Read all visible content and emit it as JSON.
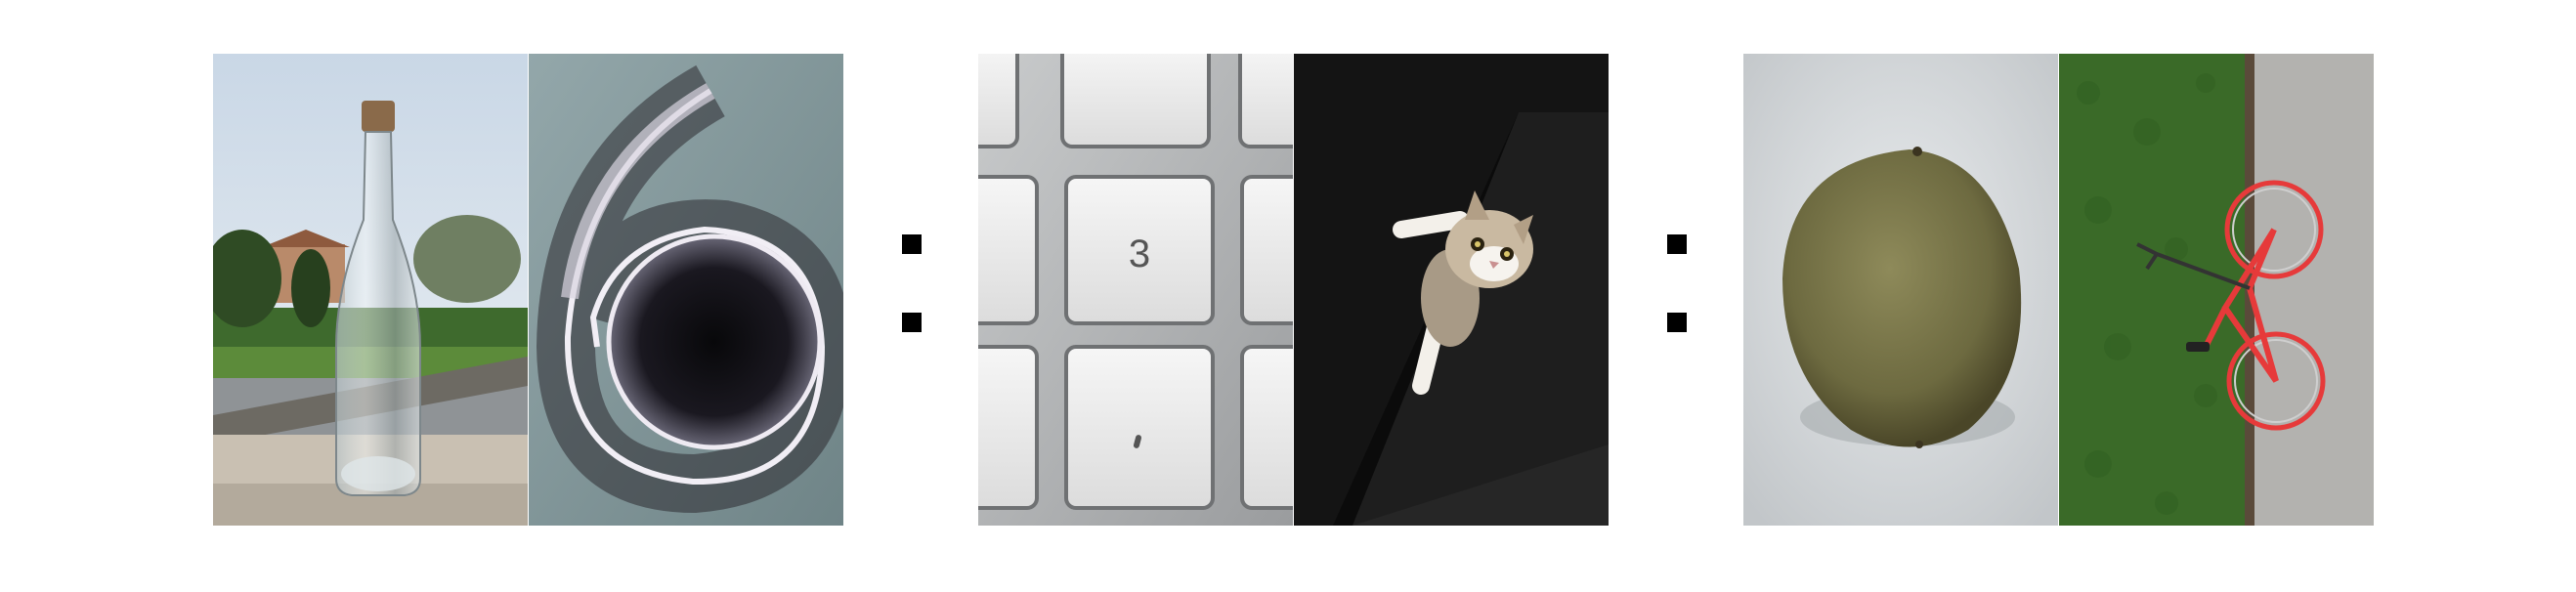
{
  "analogy": {
    "pairs": [
      {
        "left_image": "glass-bottle-photo",
        "right_image": "curled-paper-spiral-photo"
      },
      {
        "left_image": "keyboard-keys-photo",
        "right_image": "kitten-in-box-photo",
        "key_label": "3"
      },
      {
        "left_image": "kiwi-fruit-photo",
        "right_image": "red-bicycle-on-hedge-photo"
      }
    ],
    "separators": [
      "colon",
      "colon"
    ]
  }
}
